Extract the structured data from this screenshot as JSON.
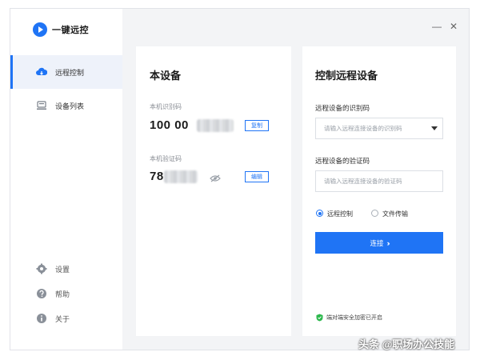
{
  "app": {
    "name": "一键远控"
  },
  "window_controls": {
    "minimize": "—",
    "close": "✕"
  },
  "sidebar": {
    "items": [
      {
        "label": "远程控制",
        "icon": "cloud-remote-icon"
      },
      {
        "label": "设备列表",
        "icon": "device-list-icon"
      }
    ],
    "bottom": [
      {
        "label": "设置",
        "icon": "gear-icon"
      },
      {
        "label": "帮助",
        "icon": "help-icon"
      },
      {
        "label": "关于",
        "icon": "info-icon"
      }
    ]
  },
  "this_device": {
    "title": "本设备",
    "id_label": "本机识别码",
    "id_value": "100 00",
    "copy_button": "复制",
    "code_label": "本机验证码",
    "code_value": "78",
    "edit_button": "编辑"
  },
  "remote": {
    "title": "控制远程设备",
    "id_label": "远程设备的识别码",
    "id_placeholder": "请输入远程连接设备的识别码",
    "code_label": "远程设备的验证码",
    "code_placeholder": "请输入远程连接设备的验证码",
    "mode_options": [
      "远程控制",
      "文件传输"
    ],
    "selected_mode": "远程控制",
    "connect_button": "连接",
    "connect_arrow": "››",
    "security_note": "端对端安全加密已开启"
  },
  "watermark": "头条 @职场办公技能",
  "colors": {
    "accent": "#1f74f5",
    "secure_green": "#2db84d"
  }
}
